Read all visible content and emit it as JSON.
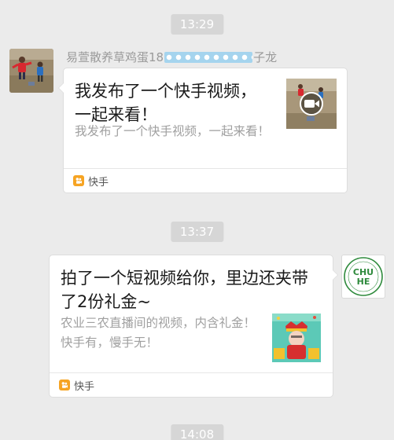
{
  "chat": {
    "times": [
      "13:29",
      "13:37",
      "14:08"
    ],
    "messages": [
      {
        "sender": {
          "name_prefix": "易萱散养草鸡蛋18",
          "name_suffix": "子龙"
        },
        "card": {
          "title": "我发布了一个快手视频，一起来看！",
          "description": "我发布了一个快手视频，一起来看！",
          "source": "快手",
          "thumbnail_icon": "video-camera-icon"
        }
      },
      {
        "sender": {
          "avatar_text": "CHU HE"
        },
        "card": {
          "title": "拍了一个短视频给你，里边还夹带了2份礼金~",
          "description": "农业三农直播间的视频，内含礼金！快手有，慢手无！",
          "source": "快手"
        }
      }
    ]
  },
  "colors": {
    "background": "#ebebeb",
    "time_pill": "#d6d6d6",
    "kuaishou_orange": "#f6a423",
    "chuhe_green": "#2e8a3c"
  }
}
